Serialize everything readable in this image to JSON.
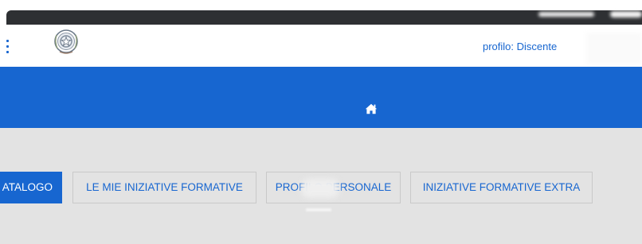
{
  "header": {
    "profile_label": "profilo: Discente"
  },
  "nav": {
    "tabs": [
      {
        "label": "ATALOGO",
        "active": true
      },
      {
        "label": "LE MIE INIZIATIVE FORMATIVE",
        "active": false
      },
      {
        "label": "PROFILO PERSONALE",
        "active": false
      },
      {
        "label": "INIZIATIVE FORMATIVE EXTRA",
        "active": false
      }
    ],
    "home_icon": "home-icon"
  },
  "colors": {
    "accent": "#1766d0",
    "background": "#e3e3e3",
    "top_bar": "#2e3033"
  }
}
